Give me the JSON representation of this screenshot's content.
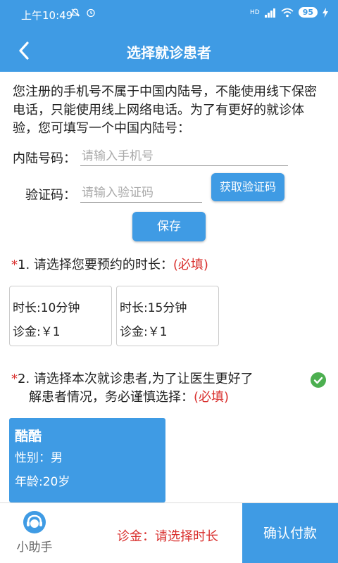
{
  "status_bar": {
    "time": "上午10:49",
    "left_icons": [
      "mute-icon",
      "alarm-icon"
    ],
    "network": "HD",
    "battery": "95"
  },
  "header": {
    "title": "选择就诊患者",
    "back_icon": "chevron-left-icon"
  },
  "notice": "您注册的手机号不属于中国内陆号，不能使用线下保密电话，只能使用线上网络电话。为了有更好的就诊体验，您可填写一个中国内陆号：",
  "phone_form": {
    "phone_label": "内陆号码：",
    "phone_placeholder": "请输入手机号",
    "phone_value": "",
    "code_label": "验证码：",
    "code_placeholder": "请输入验证码",
    "code_value": "",
    "get_code_button": "获取验证码",
    "save_button": "保存"
  },
  "duration_section": {
    "asterisk": "*",
    "title": "1. 请选择您要预约的时长：",
    "required": "(必填)",
    "options": [
      {
        "duration": "时长:10分钟",
        "fee": "诊金:￥1"
      },
      {
        "duration": "时长:15分钟",
        "fee": "诊金:￥1"
      }
    ]
  },
  "patient_section": {
    "asterisk": "*",
    "title_line1": "2. 请选择本次就诊患者,为了让医生更好了",
    "title_line2": "解患者情况，务必谨慎选择：",
    "required": "(必填)",
    "patient": {
      "name": "酷酷",
      "gender": "性别：男",
      "age": "年龄:20岁"
    }
  },
  "bottom_bar": {
    "assistant_label": "小助手",
    "fee_text": "诊金：请选择时长",
    "confirm_button": "确认付款"
  },
  "colors": {
    "primary": "#3f9be4",
    "required_red": "#d9302e",
    "check_green": "#4caf50"
  }
}
